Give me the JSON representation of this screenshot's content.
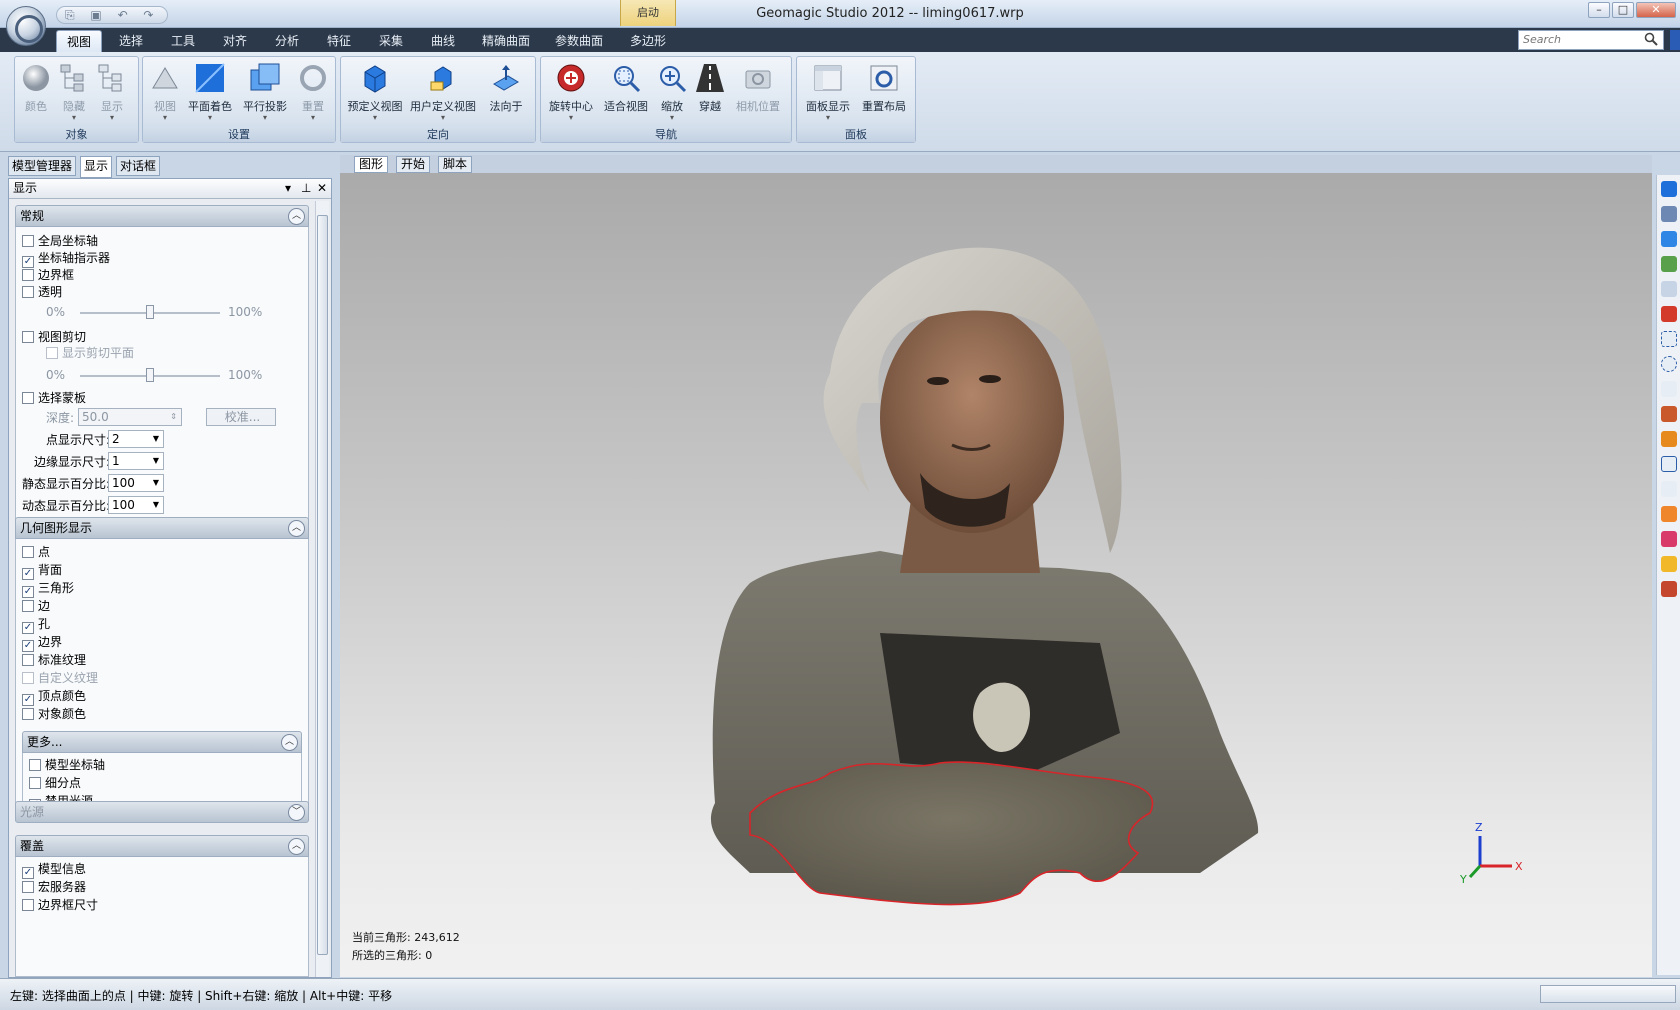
{
  "window": {
    "title": "Geomagic Studio 2012 -- liming0617.wrp",
    "context_tab": "启动",
    "qat": "⎘ ▣ ↶ ↷ ▾"
  },
  "ribbon_tabs": [
    "视图",
    "选择",
    "工具",
    "对齐",
    "分析",
    "特征",
    "采集",
    "曲线",
    "精确曲面",
    "参数曲面",
    "多边形"
  ],
  "search": {
    "placeholder": "Search"
  },
  "ribbon": {
    "groups": [
      {
        "label": "对象",
        "buttons": [
          "颜色",
          "隐藏",
          "显示"
        ]
      },
      {
        "label": "设置",
        "buttons": [
          "视图",
          "平面着色",
          "平行投影",
          "重置"
        ]
      },
      {
        "label": "定向",
        "buttons": [
          "预定义视图",
          "用户定义视图",
          "法向于"
        ]
      },
      {
        "label": "导航",
        "buttons": [
          "旋转中心",
          "适合视图",
          "缩放",
          "穿越",
          "相机位置"
        ]
      },
      {
        "label": "面板",
        "buttons": [
          "面板显示",
          "重置布局"
        ]
      }
    ]
  },
  "panel_tabs": [
    "模型管理器",
    "显示",
    "对话框"
  ],
  "panel": {
    "header": "显示",
    "general": {
      "title": "常规",
      "global_axis": "全局坐标轴",
      "axis_indicator": "坐标轴指示器",
      "bbox": "边界框",
      "transparent": "透明",
      "min1": "0%",
      "max1": "100%",
      "clip": "视图剪切",
      "show_clip_plane": "显示剪切平面",
      "min2": "0%",
      "max2": "100%",
      "mask": "选择蒙板",
      "depth_label": "深度:",
      "depth_value": "50.0",
      "calibrate": "校准...",
      "point_size_label": "点显示尺寸:",
      "point_size": "2",
      "edge_size_label": "边缘显示尺寸:",
      "edge_size": "1",
      "static_pct_label": "静态显示百分比:",
      "static_pct": "100",
      "dynamic_pct_label": "动态显示百分比:",
      "dynamic_pct": "100"
    },
    "geometry": {
      "title": "几何图形显示",
      "items": [
        {
          "label": "点",
          "checked": false
        },
        {
          "label": "背面",
          "checked": true
        },
        {
          "label": "三角形",
          "checked": true
        },
        {
          "label": "边",
          "checked": false
        },
        {
          "label": "孔",
          "checked": true
        },
        {
          "label": "边界",
          "checked": true
        },
        {
          "label": "标准纹理",
          "checked": false
        },
        {
          "label": "自定义纹理",
          "checked": false
        },
        {
          "label": "顶点颜色",
          "checked": true
        },
        {
          "label": "对象颜色",
          "checked": false
        }
      ],
      "more_title": "更多...",
      "more_items": [
        {
          "label": "模型坐标轴",
          "checked": false
        },
        {
          "label": "细分点",
          "checked": false
        },
        {
          "label": "禁用光源",
          "checked": true
        }
      ]
    },
    "lighting": {
      "title": "光源"
    },
    "overlay": {
      "title": "覆盖",
      "items": [
        {
          "label": "模型信息",
          "checked": true
        },
        {
          "label": "宏服务器",
          "checked": false
        },
        {
          "label": "边界框尺寸",
          "checked": false
        }
      ]
    }
  },
  "viewport": {
    "tabs": [
      "图形",
      "开始",
      "脚本"
    ],
    "current_triangles": "当前三角形: 243,612",
    "selected_triangles": "所选的三角形: 0",
    "axis_labels": {
      "z": "Z",
      "x": "X",
      "y": "Y"
    }
  },
  "status": {
    "text": "左键: 选择曲面上的点 | 中键: 旋转 | Shift+右键: 缩放 | Alt+中键: 平移"
  },
  "colors": {
    "ribbon_dark": "#2c394a",
    "accent_blue": "#1e6fd9",
    "boundary_red": "#d8252a"
  }
}
